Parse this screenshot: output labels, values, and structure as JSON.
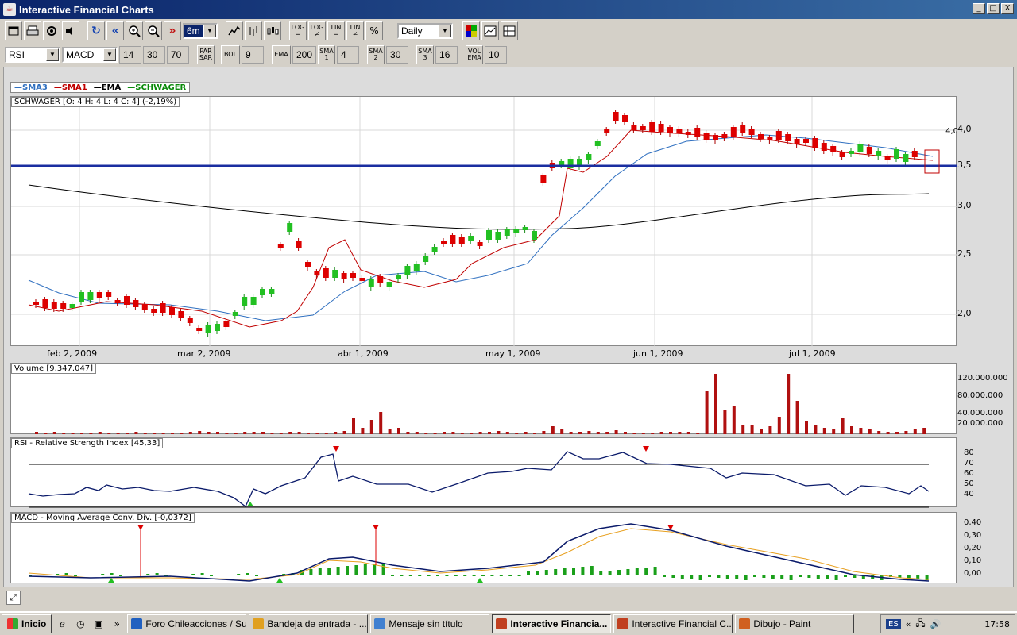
{
  "window": {
    "title": "Interactive Financial Charts",
    "min": "_",
    "max": "□",
    "close": "X"
  },
  "toolbar1": {
    "range_value": "6m",
    "log1": [
      "LOG",
      "="
    ],
    "log2": [
      "LOG",
      "≠"
    ],
    "lin1": [
      "LIN",
      "="
    ],
    "lin2": [
      "LIN",
      "≠"
    ],
    "pct": "%",
    "period_value": "Daily"
  },
  "toolbar2": {
    "indicator1": "RSI",
    "indicator2": "MACD",
    "rsi_params": [
      "14",
      "30",
      "70"
    ],
    "parsar": [
      "PAR",
      "SAR"
    ],
    "bol_label": "BOL",
    "bol_value": "9",
    "ema_label": "EMA",
    "ema_value": "200",
    "sma1_label": [
      "SMA",
      "1"
    ],
    "sma1_value": "4",
    "sma2_label": [
      "SMA",
      "2"
    ],
    "sma2_value": "30",
    "sma3_label": [
      "SMA",
      "3"
    ],
    "sma3_value": "16",
    "volema_label": [
      "VOL",
      "EMA"
    ],
    "volema_value": "10"
  },
  "legend": {
    "sma3": "SMA3",
    "sma1": "SMA1",
    "ema": "EMA",
    "schwager": "SCHWAGER"
  },
  "price_tag": "SCHWAGER [O: 4  H: 4  L: 4  C: 4] (-2,19%)",
  "x_labels": [
    "feb 2, 2009",
    "mar 2, 2009",
    "abr 1, 2009",
    "may 1, 2009",
    "jun 1, 2009",
    "jul 1, 2009"
  ],
  "price_axis": [
    "4,0",
    "3,5",
    "3,0",
    "2,5",
    "2,0"
  ],
  "volume_tag": "Volume [9.347.047]",
  "volume_axis": [
    "120.000.000",
    "80.000.000",
    "40.000.000",
    "20.000.000"
  ],
  "rsi_tag": "RSI - Relative Strength Index [45,33]",
  "rsi_axis": [
    "80",
    "70",
    "60",
    "50",
    "40"
  ],
  "macd_tag": "MACD - Moving Average Conv. Div. [-0,0372]",
  "macd_axis": [
    "0,40",
    "0,30",
    "0,20",
    "0,10",
    "0,00"
  ],
  "colors": {
    "up": "#22c022",
    "down": "#dd0000",
    "sma3": "#3070c0",
    "sma1": "#c00000",
    "ema": "#000000",
    "level": "#1a2ea0",
    "volume": "#b01010",
    "signal": "#e8a020"
  },
  "taskbar": {
    "start": "Inicio",
    "tasks": [
      {
        "label": "Foro Chileacciones / Su...",
        "color": "#2060c0"
      },
      {
        "label": "Bandeja de entrada - ...",
        "color": "#e0a020"
      },
      {
        "label": "Mensaje sin título",
        "color": "#4080d0"
      },
      {
        "label": "Interactive Financia...",
        "color": "#c04020",
        "active": true
      },
      {
        "label": "Interactive Financial C...",
        "color": "#c04020"
      },
      {
        "label": "Dibujo - Paint",
        "color": "#d06020"
      }
    ],
    "lang": "ES",
    "clock": "17:58"
  }
}
